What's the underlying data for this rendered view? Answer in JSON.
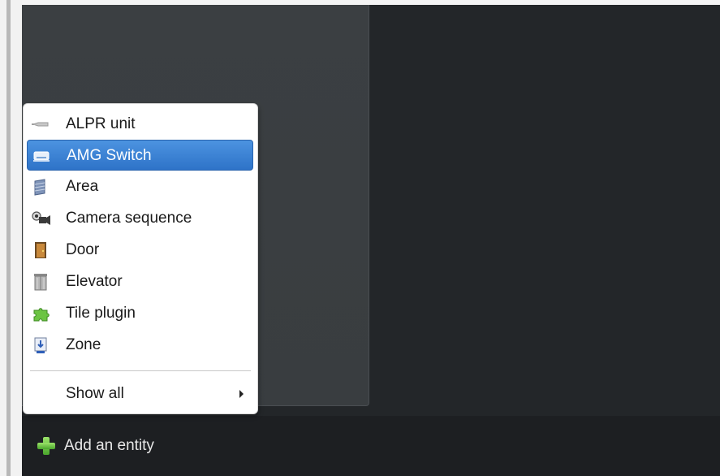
{
  "menu": {
    "items": [
      {
        "label": "ALPR unit",
        "icon": "alpr-unit-icon",
        "selected": false
      },
      {
        "label": "AMG Switch",
        "icon": "amg-switch-icon",
        "selected": true
      },
      {
        "label": "Area",
        "icon": "area-icon",
        "selected": false
      },
      {
        "label": "Camera sequence",
        "icon": "camera-sequence-icon",
        "selected": false
      },
      {
        "label": "Door",
        "icon": "door-icon",
        "selected": false
      },
      {
        "label": "Elevator",
        "icon": "elevator-icon",
        "selected": false
      },
      {
        "label": "Tile plugin",
        "icon": "tile-plugin-icon",
        "selected": false
      },
      {
        "label": "Zone",
        "icon": "zone-icon",
        "selected": false
      }
    ],
    "show_all": {
      "label": "Show all"
    }
  },
  "bottom_bar": {
    "add_entity_label": "Add an entity"
  },
  "colors": {
    "selection": "#3a82d4",
    "background_dark": "#232629",
    "tile_panel": "#3b3f42",
    "add_icon": "#6cc443"
  }
}
